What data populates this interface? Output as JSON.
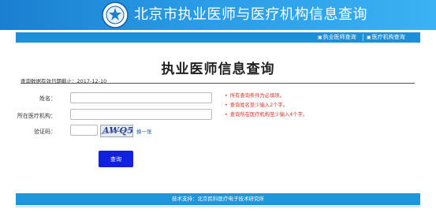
{
  "header": {
    "site_title": "北京市执业医师与医疗机构信息查询",
    "logo_icon": "emblem-icon"
  },
  "nav": {
    "items": [
      {
        "label": "执业医师查询",
        "icon": "doctor-icon"
      },
      {
        "label": "医疗机构查询",
        "icon": "hospital-icon"
      }
    ]
  },
  "main": {
    "heading": "执业医师信息查询",
    "updated_text": "查询数据有效日期截止：2017-12-10"
  },
  "form": {
    "name_label": "姓名：",
    "org_label": "所在医疗机构：",
    "captcha_label": "验证码：",
    "name_value": "",
    "org_value": "",
    "captcha_value": "",
    "captcha_text": "AWQ5A",
    "refresh_label": "换一张",
    "search_button": "查询"
  },
  "hints": [
    "所有查询条件为必填项。",
    "查询姓名至少输入2个字。",
    "查询所在医疗机构至少输入4个字。"
  ],
  "footer": {
    "text": "技术支持：北京民科医疗电子技术研究所"
  },
  "colors": {
    "banner": "#1a7fd0",
    "nav": "#1d8fd8",
    "button": "#1220e0",
    "hint": "#d9352b"
  }
}
